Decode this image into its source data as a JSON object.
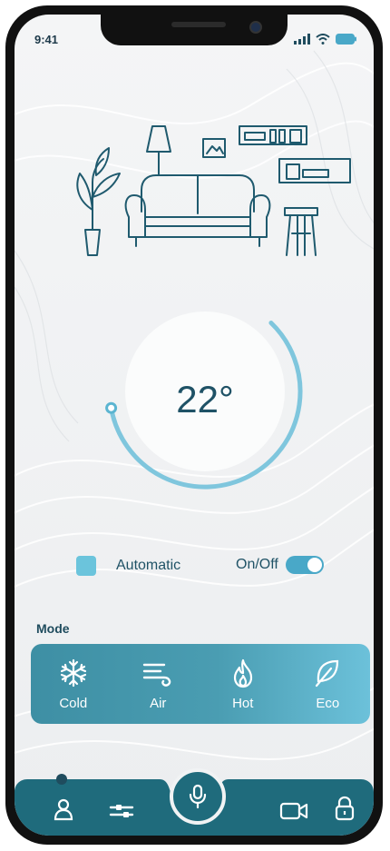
{
  "status": {
    "time": "9:41",
    "icons": [
      "signal-icon",
      "wifi-icon",
      "battery-icon"
    ]
  },
  "thermostat": {
    "temperature": "22°",
    "dial_level": 0.72
  },
  "controls": {
    "automatic_label": "Automatic",
    "onoff_label": "On/Off",
    "onoff_state": "on"
  },
  "mode": {
    "title": "Mode",
    "items": [
      {
        "label": "Cold",
        "icon": "snowflake-icon"
      },
      {
        "label": "Air",
        "icon": "wind-icon"
      },
      {
        "label": "Hot",
        "icon": "flame-icon"
      },
      {
        "label": "Eco",
        "icon": "leaf-icon"
      }
    ]
  },
  "nav": {
    "items": [
      "user-icon",
      "sliders-icon",
      "microphone-icon",
      "video-camera-icon",
      "lock-icon"
    ]
  },
  "colors": {
    "accent": "#49a8c8",
    "dark": "#1f6b7c",
    "text": "#1f5266"
  }
}
